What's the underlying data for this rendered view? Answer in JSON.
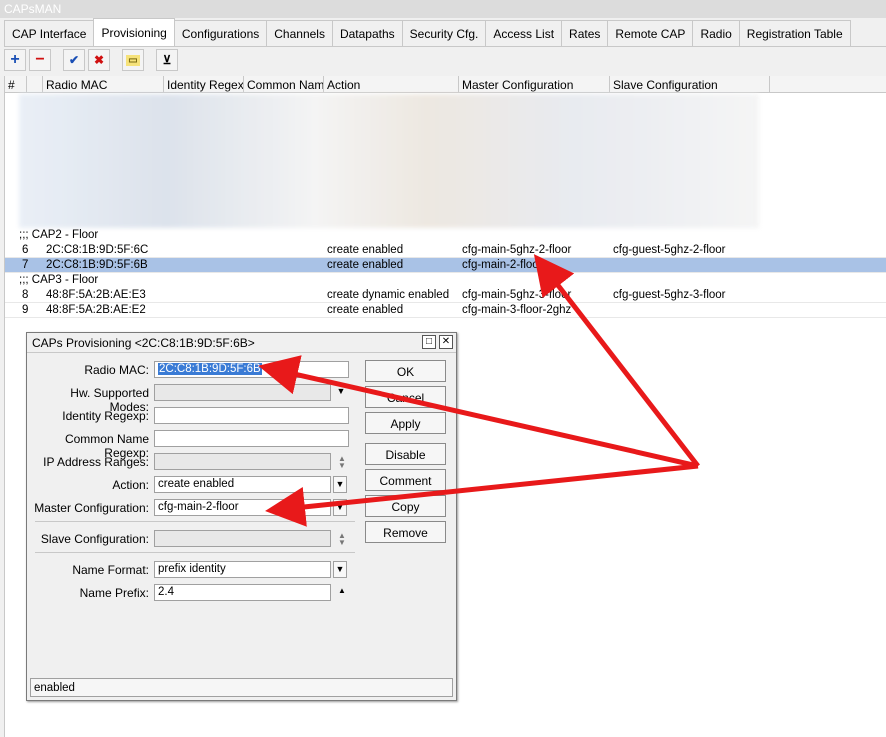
{
  "window": {
    "title": "CAPsMAN"
  },
  "tabs": [
    {
      "label": "CAP Interface"
    },
    {
      "label": "Provisioning"
    },
    {
      "label": "Configurations"
    },
    {
      "label": "Channels"
    },
    {
      "label": "Datapaths"
    },
    {
      "label": "Security Cfg."
    },
    {
      "label": "Access List"
    },
    {
      "label": "Rates"
    },
    {
      "label": "Remote CAP"
    },
    {
      "label": "Radio"
    },
    {
      "label": "Registration Table"
    }
  ],
  "toolbar": {
    "add": "+",
    "remove": "−",
    "enable": "✔",
    "disable": "✖",
    "comment": "▭",
    "filter": "⊻"
  },
  "table": {
    "columns": [
      "#",
      "Radio MAC",
      "Identity Regexp",
      "Common Nam...",
      "Action",
      "Master Configuration",
      "Slave Configuration"
    ],
    "comment_cap2": ";;; CAP2 - Floor",
    "comment_cap3": ";;; CAP3 - Floor",
    "rows": [
      {
        "num": "6",
        "mac": "2C:C8:1B:9D:5F:6C",
        "identity": "",
        "common": "",
        "action": "create enabled",
        "master": "cfg-main-5ghz-2-floor",
        "slave": "cfg-guest-5ghz-2-floor"
      },
      {
        "num": "7",
        "mac": "2C:C8:1B:9D:5F:6B",
        "identity": "",
        "common": "",
        "action": "create enabled",
        "master": "cfg-main-2-floor",
        "slave": ""
      },
      {
        "num": "8",
        "mac": "48:8F:5A:2B:AE:E3",
        "identity": "",
        "common": "",
        "action": "create dynamic enabled",
        "master": "cfg-main-5ghz-3-floor",
        "slave": "cfg-guest-5ghz-3-floor"
      },
      {
        "num": "9",
        "mac": "48:8F:5A:2B:AE:E2",
        "identity": "",
        "common": "",
        "action": "create enabled",
        "master": "cfg-main-3-floor-2ghz",
        "slave": ""
      }
    ]
  },
  "dialog": {
    "title": "CAPs Provisioning <2C:C8:1B:9D:5F:6B>",
    "labels": {
      "radio_mac": "Radio MAC:",
      "hw_modes": "Hw. Supported Modes:",
      "identity": "Identity Regexp:",
      "common_name": "Common Name Regexp:",
      "ip_ranges": "IP Address Ranges:",
      "action": "Action:",
      "master": "Master Configuration:",
      "slave": "Slave Configuration:",
      "name_format": "Name Format:",
      "name_prefix": "Name Prefix:"
    },
    "values": {
      "radio_mac": "2C:C8:1B:9D:5F:6B",
      "hw_modes": "",
      "identity": "",
      "common_name": "",
      "ip_ranges": "",
      "action": "create enabled",
      "master": "cfg-main-2-floor",
      "slave": "",
      "name_format": "prefix identity",
      "name_prefix": "2.4"
    },
    "buttons": {
      "ok": "OK",
      "cancel": "Cancel",
      "apply": "Apply",
      "disable": "Disable",
      "comment": "Comment",
      "copy": "Copy",
      "remove": "Remove"
    },
    "status": "enabled"
  },
  "colors": {
    "selection": "#a9c2e6",
    "arrow": "#e8191a",
    "highlight": "#3a7bd5"
  }
}
